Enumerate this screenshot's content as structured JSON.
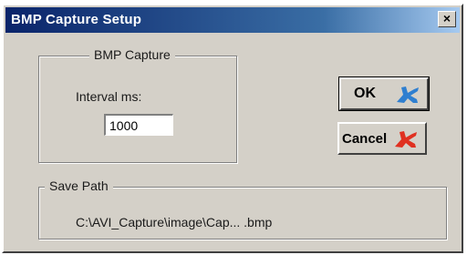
{
  "window": {
    "title": "BMP Capture Setup",
    "close_glyph": "×"
  },
  "capture_group": {
    "legend": "BMP Capture",
    "interval_label": "Interval  ms:",
    "interval_value": "1000"
  },
  "buttons": {
    "ok_label": "OK",
    "cancel_label": "Cancel"
  },
  "icons": {
    "ok": {
      "name": "runner-icon",
      "color": "#2f7fd0"
    },
    "cancel": {
      "name": "runner-icon",
      "color": "#e03020"
    }
  },
  "save_group": {
    "legend": "Save Path",
    "path": "C:\\AVI_Capture\\image\\Cap...  .bmp"
  }
}
